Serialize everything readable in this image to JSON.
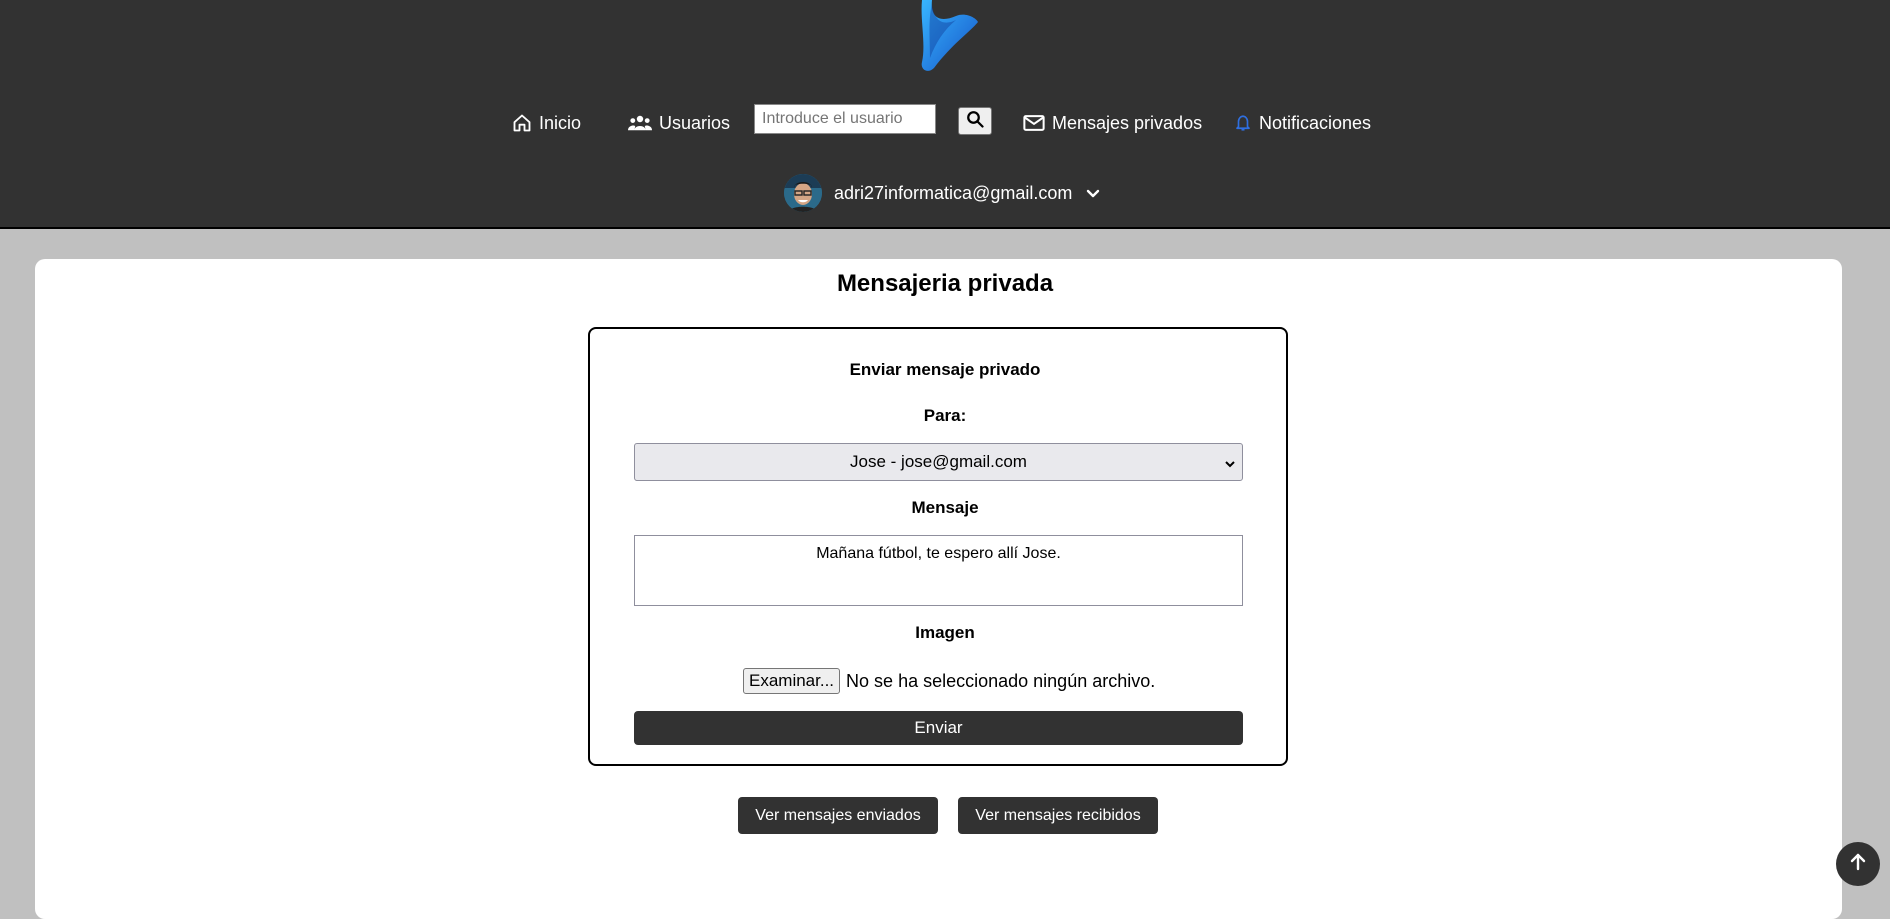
{
  "nav": {
    "home": "Inicio",
    "users": "Usuarios",
    "search_placeholder": "Introduce el usuario",
    "messages": "Mensajes privados",
    "notifications": "Notificaciones"
  },
  "user": {
    "email": "adri27informatica@gmail.com"
  },
  "page": {
    "title": "Mensajeria privada"
  },
  "form": {
    "heading": "Enviar mensaje privado",
    "to_label": "Para:",
    "to_selected": "Jose - jose@gmail.com",
    "message_label": "Mensaje",
    "message_value": "Mañana fútbol, te espero allí Jose.",
    "image_label": "Imagen",
    "file_button": "Examinar...",
    "file_status": "No se ha seleccionado ningún archivo.",
    "submit": "Enviar"
  },
  "actions": {
    "sent": "Ver mensajes enviados",
    "received": "Ver mensajes recibidos"
  },
  "colors": {
    "header_bg": "#323232",
    "page_bg": "#c0c0c0",
    "button_bg": "#323232",
    "bell_accent": "#2f6fe0",
    "logo_blue": "#1f8fe0"
  },
  "icons": {
    "logo": "brand-logo-icon",
    "home": "home-icon",
    "users": "users-icon",
    "search": "search-icon",
    "messages": "mail-icon",
    "notifications": "bell-icon",
    "user_menu": "chevron-down-icon",
    "scroll_top": "arrow-up-icon"
  }
}
